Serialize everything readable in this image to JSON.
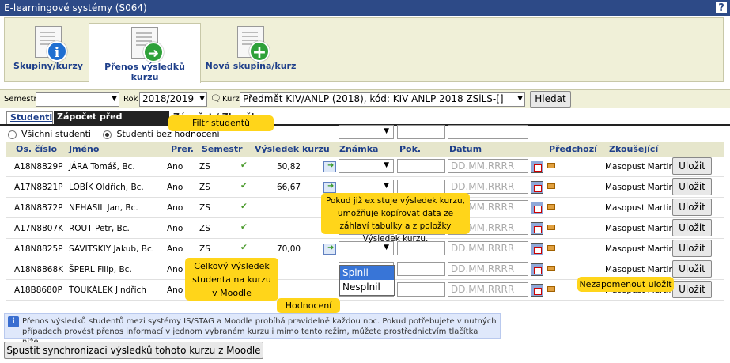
{
  "window": {
    "title": "E-learningové systémy (S064)",
    "help": "?"
  },
  "iconbar": {
    "items": [
      {
        "label": "Skupiny/kurzy",
        "icon": "info-icon",
        "color": "#1f6fd1",
        "glyph": "i"
      },
      {
        "label": "Přenos výsledků kurzu",
        "icon": "arrow-right-icon",
        "color": "#2fa13a",
        "glyph": "➜"
      },
      {
        "label": "Nová skupina/kurz",
        "icon": "plus-icon",
        "color": "#2fa13a",
        "glyph": "+"
      }
    ]
  },
  "filter": {
    "semestr_label": "Semestr",
    "semestr_value": "",
    "rok_label": "Rok",
    "rok_value": "2018/2019",
    "kurz_label": "Kurz",
    "kurz_value": "Předmět KIV/ANLP (2018), kód: KIV ANLP 2018 ZSiLS-[]",
    "search_button": "Hledat"
  },
  "tabs": [
    {
      "label": "Studenti"
    },
    {
      "label": "Zápočet před zkouškou"
    },
    {
      "label": "Zápočet / Zkouška"
    }
  ],
  "radios": {
    "all": "Všichni studenti",
    "without": "Studenti bez hodnocení"
  },
  "header_inputs": {
    "znamka": "",
    "pok": "",
    "datum": ""
  },
  "columns": [
    "Os. číslo",
    "Jméno",
    "Prer.",
    "Semestr",
    "Výsledek kurzu",
    "Známka",
    "Pok.",
    "Datum",
    "Předchozí",
    "Zkoušející"
  ],
  "rows": [
    {
      "id": "A18N8829P",
      "name": "JÁRA Tomáš, Bc.",
      "prer": "Ano",
      "sem": "ZS",
      "check": "✔",
      "result": "50,82",
      "date": "DD.MM.RRRR",
      "exam": "Masopust Martin",
      "save": "Uložit"
    },
    {
      "id": "A17N8821P",
      "name": "LOBÍK Oldřich, Bc.",
      "prer": "Ano",
      "sem": "ZS",
      "check": "✔",
      "result": "66,67",
      "date": "DD.MM.RRRR",
      "exam": "Masopust Martin",
      "save": "Uložit"
    },
    {
      "id": "A18N8872P",
      "name": "NEHASIL Jan, Bc.",
      "prer": "Ano",
      "sem": "ZS",
      "check": "✔",
      "result": "",
      "date": "DD.MM.RRRR",
      "exam": "Masopust Martin",
      "save": "Uložit"
    },
    {
      "id": "A17N8807K",
      "name": "ROUT Petr, Bc.",
      "prer": "Ano",
      "sem": "ZS",
      "check": "✔",
      "result": "",
      "date": "DD.MM.RRRR",
      "exam": "Masopust Martin",
      "save": "Uložit"
    },
    {
      "id": "A18N8825P",
      "name": "SAVITSKIY Jakub, Bc.",
      "prer": "Ano",
      "sem": "ZS",
      "check": "✔",
      "result": "70,00",
      "date": "DD.MM.RRRR",
      "exam": "Masopust Martin",
      "save": "Uložit"
    },
    {
      "id": "A18N8868K",
      "name": "ŠPERL Filip, Bc.",
      "prer": "Ano",
      "sem": "",
      "check": "",
      "result": "",
      "date": "DD.MM.RRRR",
      "exam": "Masopust Martin",
      "save": "Uložit"
    },
    {
      "id": "A18B8680P",
      "name": "ŤOUKÁLEK Jindřich",
      "prer": "Ano",
      "sem": "",
      "check": "",
      "result": "",
      "date": "DD.MM.RRRR",
      "exam": "Masopust Martin",
      "save": "Uložit"
    }
  ],
  "dropdown_popup": {
    "options": [
      "Splnil",
      "Nesplnil"
    ]
  },
  "tooltips": {
    "filter": "Filtr studentů",
    "copy": "Pokud již existuje výsledek kurzu, umožňuje kopírovat data ze záhlaví tabulky a z položky Výsledek kurzu.",
    "result": "Celkový výsledek studenta na kurzu v Moodle",
    "grade": "Hodnocení",
    "save": "Nezapomenout uložit"
  },
  "info": "Přenos výsledků studentů mezi systémy IS/STAG a Moodle probíhá pravidelně každou noc. Pokud potřebujete v nutných případech provést přenos informací v jednom vybraném kurzu i mimo tento režim, můžete prostřednictvím tlačítka níže.",
  "sync_button": "Spustit synchronizaci výsledků tohoto kurzu z Moodle"
}
